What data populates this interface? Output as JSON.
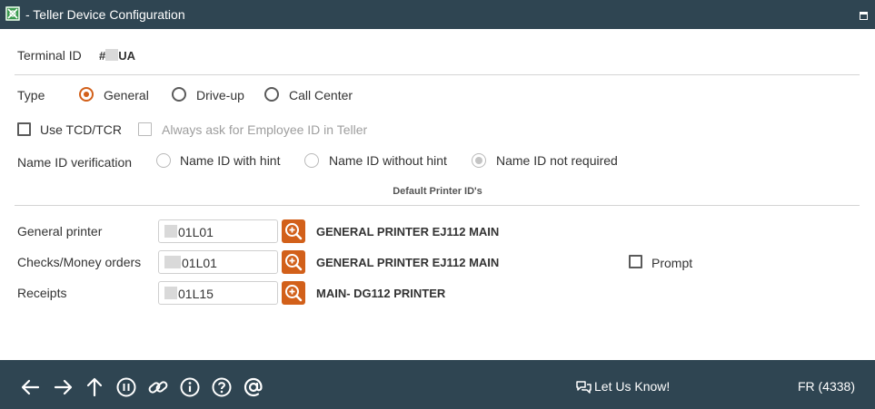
{
  "window": {
    "title": "- Teller Device Configuration"
  },
  "terminal": {
    "label": "Terminal ID",
    "value_prefix": "#",
    "value_suffix": "UA"
  },
  "type": {
    "label": "Type",
    "options": [
      {
        "label": "General",
        "selected": true
      },
      {
        "label": "Drive-up",
        "selected": false
      },
      {
        "label": "Call Center",
        "selected": false
      }
    ]
  },
  "options": {
    "use_tcd_label": "Use TCD/TCR",
    "use_tcd_checked": false,
    "always_ask_label": "Always ask for Employee ID in Teller",
    "always_ask_checked": false,
    "always_ask_disabled": true
  },
  "name_id": {
    "label": "Name ID verification",
    "options": [
      {
        "label": "Name ID with hint",
        "selected": false
      },
      {
        "label": "Name ID without hint",
        "selected": false
      },
      {
        "label": "Name ID not required",
        "selected": true
      }
    ]
  },
  "printers": {
    "section_title": "Default Printer ID's",
    "rows": [
      {
        "label": "General printer",
        "id_suffix": "01L01",
        "name": "GENERAL PRINTER EJ112 MAIN"
      },
      {
        "label": "Checks/Money orders",
        "id_suffix": "01L01",
        "name": "GENERAL PRINTER EJ112 MAIN"
      },
      {
        "label": "Receipts",
        "id_suffix": "01L15",
        "name": "MAIN- DG112 PRINTER"
      }
    ],
    "prompt_label": "Prompt",
    "prompt_checked": false
  },
  "footer": {
    "nav_icons": [
      "back-arrow-icon",
      "forward-arrow-icon",
      "up-arrow-icon",
      "pause-icon",
      "link-icon",
      "info-icon",
      "help-icon",
      "at-sign-icon"
    ],
    "feedback_label": "Let Us Know!",
    "status_code": "FR (4338)"
  },
  "colors": {
    "header_bg": "#2f4552",
    "accent": "#d2601a",
    "app_icon": "#3a9a4e"
  }
}
